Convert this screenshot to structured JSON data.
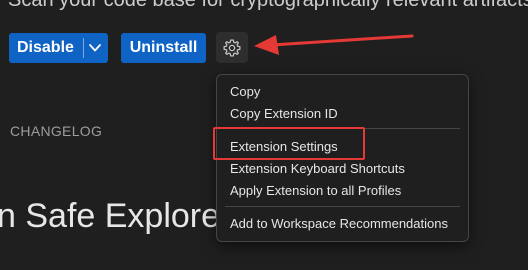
{
  "extension": {
    "description": "Scan your code base for cryptographically relevant artifacts",
    "display_name_fragment": "n Safe Explore"
  },
  "actions": {
    "disable_label": "Disable",
    "uninstall_label": "Uninstall"
  },
  "tabs": {
    "changelog_label": "CHANGELOG"
  },
  "context_menu": {
    "items": [
      "Copy",
      "Copy Extension ID",
      "Extension Settings",
      "Extension Keyboard Shortcuts",
      "Apply Extension to all Profiles",
      "Add to Workspace Recommendations"
    ]
  },
  "annotation": {
    "color": "#e53935"
  },
  "icons": {
    "gear": "gear-icon",
    "dropdown": "chevron-down-icon",
    "arrow": "arrow-left-icon"
  }
}
